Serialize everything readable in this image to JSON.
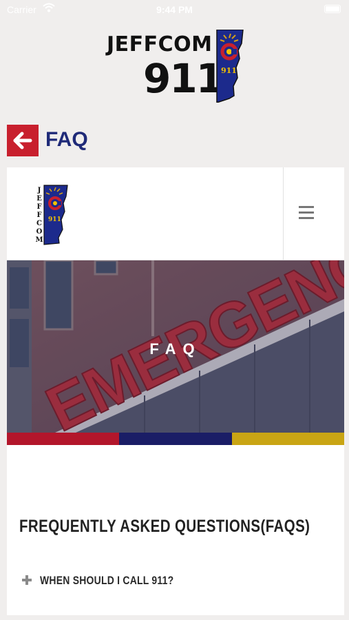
{
  "status_bar": {
    "carrier": "Carrier",
    "time": "9:44 PM"
  },
  "app_logo": {
    "wordmark": "JEFFCOM",
    "number": "911",
    "badge_text": "911"
  },
  "header": {
    "title": "FAQ"
  },
  "site": {
    "logo_letters": [
      "J",
      "E",
      "F",
      "F",
      "C",
      "O",
      "M"
    ],
    "logo_badge_text": "911",
    "hero_sign_text": "EMERGENCY",
    "hero_title": "FAQ",
    "strip_colors": [
      "#b3162b",
      "#1a1d66",
      "#c9a514"
    ],
    "faq_heading": "FREQUENTLY ASKED QUESTIONS(FAQS)",
    "faq_items": [
      {
        "question": "WHEN SHOULD I CALL 911?"
      }
    ]
  },
  "colors": {
    "accent_red": "#c8202e",
    "title_blue": "#1f2a78",
    "background": "#f0eeed"
  }
}
